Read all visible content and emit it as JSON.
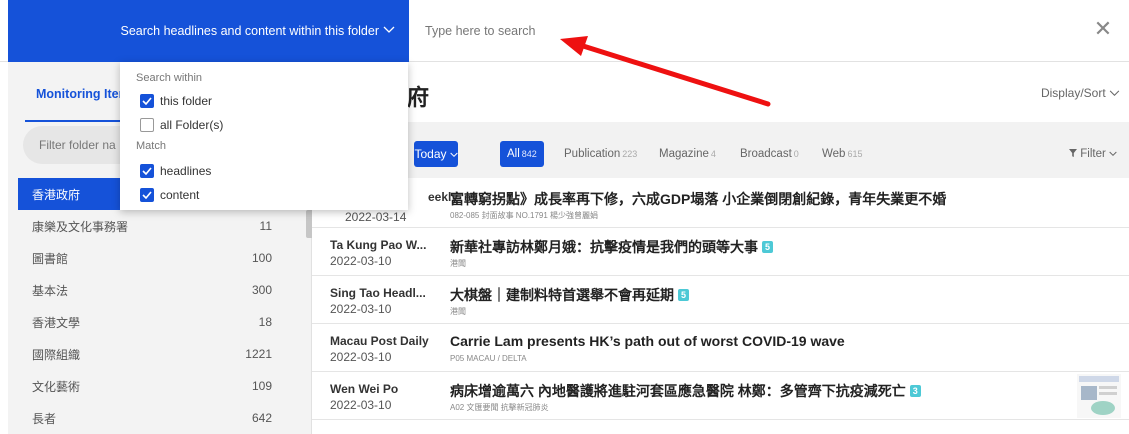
{
  "search": {
    "scope_label": "Search headlines and content within this folder",
    "placeholder": "Type here to search"
  },
  "dropdown": {
    "search_within_label": "Search within",
    "options_within": [
      {
        "label": "this folder",
        "checked": true
      },
      {
        "label": "all Folder(s)",
        "checked": false
      }
    ],
    "match_label": "Match",
    "options_match": [
      {
        "label": "headlines",
        "checked": true
      },
      {
        "label": "content",
        "checked": true
      }
    ]
  },
  "sidebar": {
    "tab_label": "Monitoring Iter",
    "filter_placeholder": "Filter folder na",
    "items": [
      {
        "name": "香港政府",
        "count": ""
      },
      {
        "name": "康樂及文化事務署",
        "count": "11"
      },
      {
        "name": "圖書館",
        "count": "100"
      },
      {
        "name": "基本法",
        "count": "300"
      },
      {
        "name": "香港文學",
        "count": "18"
      },
      {
        "name": "國際組織",
        "count": "1221"
      },
      {
        "name": "文化藝術",
        "count": "109"
      },
      {
        "name": "長者",
        "count": "642"
      }
    ]
  },
  "main": {
    "title": "府",
    "display_sort": "Display/Sort",
    "today_label": "Today",
    "type_tabs": [
      {
        "label": "All",
        "count": "842"
      },
      {
        "label": "Publication",
        "count": "223"
      },
      {
        "label": "Magazine",
        "count": "4"
      },
      {
        "label": "Broadcast",
        "count": "0"
      },
      {
        "label": "Web",
        "count": "615"
      }
    ],
    "filter_label": "Filter"
  },
  "results": [
    {
      "source": "eekly",
      "date": "2022-03-14",
      "headline": "富轉窮拐點》成長率再下修，六成GDP塌落 小企業倒閉創紀錄，青年失業更不婚",
      "sub": "082-085 封面故事 NO.1791 楊少強曾麗娟",
      "badge": ""
    },
    {
      "source": "Ta Kung Pao W...",
      "date": "2022-03-10",
      "headline": "新華社專訪林鄭月娥：抗擊疫情是我們的頭等大事",
      "sub": "港聞",
      "badge": "5"
    },
    {
      "source": "Sing Tao Headl...",
      "date": "2022-03-10",
      "headline": "大棋盤｜建制料特首選舉不會再延期",
      "sub": "港聞",
      "badge": "5"
    },
    {
      "source": "Macau Post Daily",
      "date": "2022-03-10",
      "headline": "Carrie Lam presents HK’s path out of worst COVID-19 wave",
      "sub": "P05 MACAU / DELTA",
      "badge": ""
    },
    {
      "source": "Wen Wei Po",
      "date": "2022-03-10",
      "headline": "病床增逾萬六 內地醫護將進駐河套區應急醫院 林鄭：多管齊下抗疫減死亡",
      "sub": "A02 文匯要聞 抗擊新冠肺炎",
      "badge": "3"
    }
  ],
  "colors": {
    "primary": "#1552d9",
    "badge": "#4dc9d6",
    "annotation_arrow": "#ee1111"
  },
  "icons": [
    "chevron-down-icon",
    "close-icon",
    "checkbox-checked-icon",
    "filter-icon",
    "red-annotation-arrow"
  ]
}
